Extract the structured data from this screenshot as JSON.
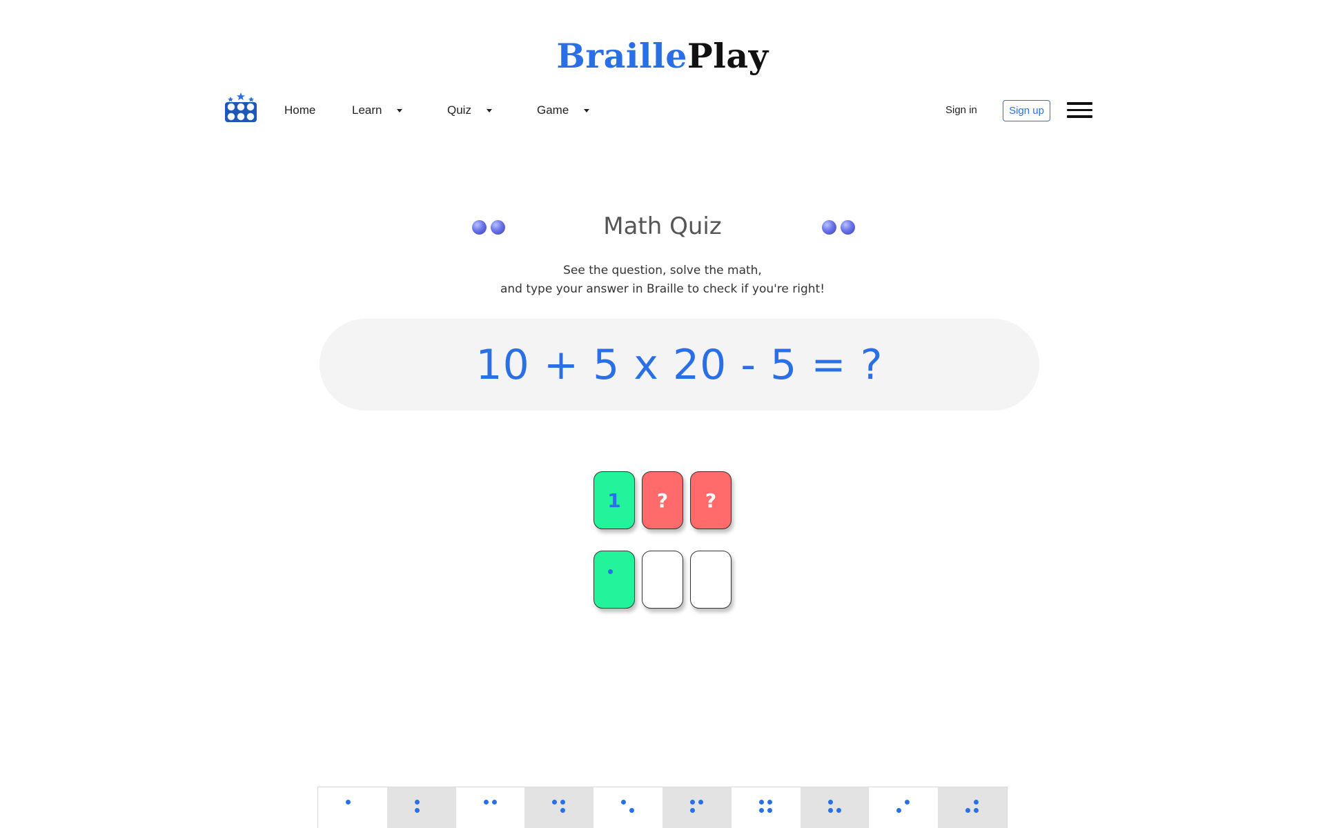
{
  "brand": {
    "part1": "Braille",
    "part2": "Play"
  },
  "nav": {
    "items": [
      {
        "label": "Home",
        "has_dropdown": false
      },
      {
        "label": "Learn",
        "has_dropdown": true
      },
      {
        "label": "Quiz",
        "has_dropdown": true
      },
      {
        "label": "Game",
        "has_dropdown": true
      }
    ],
    "sign_in": "Sign in",
    "sign_up": "Sign up",
    "menu_icon": "hamburger-menu-icon",
    "logo_icon": "braille-cell-stars-icon"
  },
  "quiz": {
    "title": "Math Quiz",
    "subtitle_line1": "See the question, solve the math,",
    "subtitle_line2": "and type your answer in Braille to check if you're right!",
    "question": "10 + 5 x 20 - 5 = ?",
    "answer_digits": [
      {
        "value": "1",
        "state": "correct"
      },
      {
        "value": "?",
        "state": "wrong"
      },
      {
        "value": "?",
        "state": "wrong"
      }
    ],
    "braille_inputs": [
      {
        "state": "correct",
        "dots": [
          1
        ]
      },
      {
        "state": "empty",
        "dots": []
      },
      {
        "state": "empty",
        "dots": []
      }
    ]
  },
  "keyboard": {
    "keys": [
      {
        "digit": "1",
        "dots": [
          1
        ]
      },
      {
        "digit": "2",
        "dots": [
          1,
          2
        ]
      },
      {
        "digit": "3",
        "dots": [
          1,
          4
        ]
      },
      {
        "digit": "4",
        "dots": [
          1,
          4,
          5
        ]
      },
      {
        "digit": "5",
        "dots": [
          1,
          5
        ]
      },
      {
        "digit": "6",
        "dots": [
          1,
          2,
          4
        ]
      },
      {
        "digit": "7",
        "dots": [
          1,
          2,
          4,
          5
        ]
      },
      {
        "digit": "8",
        "dots": [
          1,
          2,
          5
        ]
      },
      {
        "digit": "9",
        "dots": [
          2,
          4
        ]
      },
      {
        "digit": "0",
        "dots": [
          2,
          4,
          5
        ]
      }
    ]
  },
  "colors": {
    "accent": "#2b6fe6",
    "correct": "#23f39a",
    "wrong": "#ff6b6b",
    "pill_bg": "#f4f4f4"
  }
}
